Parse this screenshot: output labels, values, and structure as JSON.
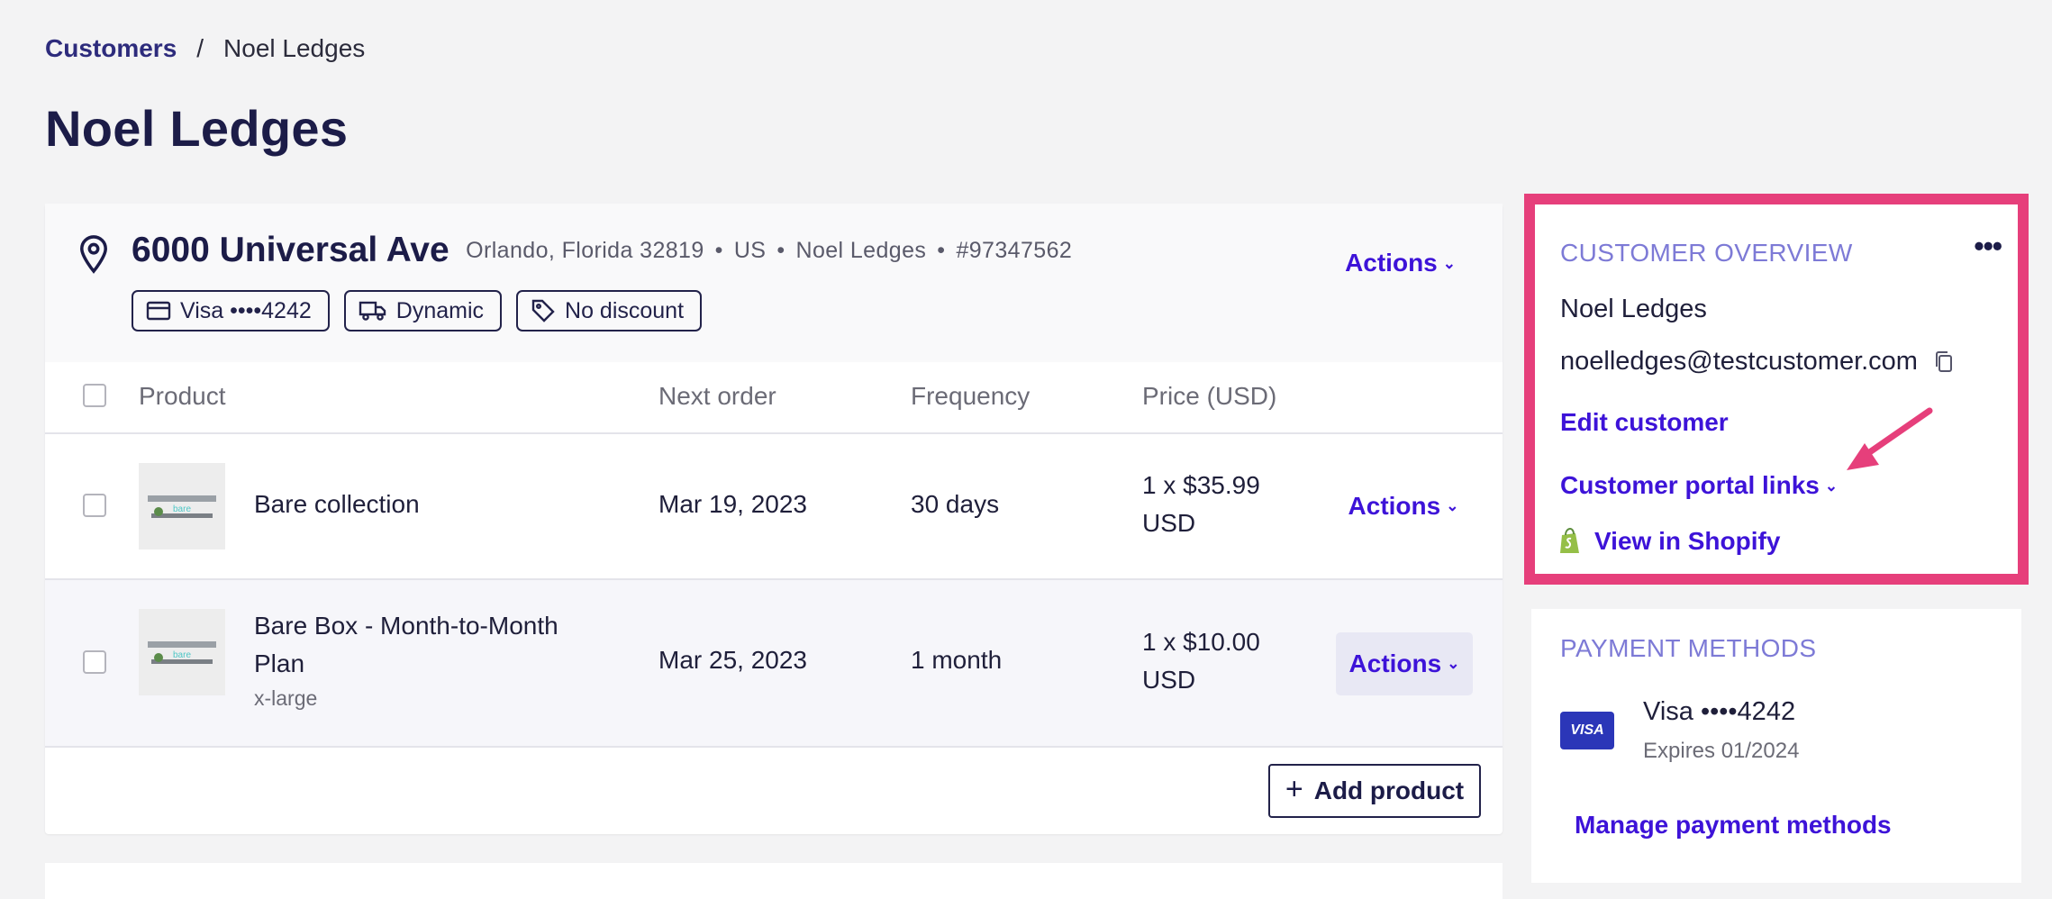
{
  "breadcrumb": {
    "parent": "Customers",
    "separator": "/",
    "current": "Noel Ledges"
  },
  "page_title": "Noel Ledges",
  "subscription": {
    "street": "6000 Universal Ave",
    "city_state_zip": "Orlando, Florida 32819",
    "country": "US",
    "customer_name": "Noel Ledges",
    "order_id": "#97347562",
    "dot": "•",
    "chips": {
      "payment": "Visa ••••4242",
      "shipping": "Dynamic",
      "discount": "No discount"
    },
    "actions_label": "Actions"
  },
  "table": {
    "headers": {
      "product": "Product",
      "next_order": "Next order",
      "frequency": "Frequency",
      "price": "Price (USD)"
    },
    "rows": [
      {
        "product": "Bare collection",
        "variant": "",
        "next_order": "Mar 19, 2023",
        "frequency": "30 days",
        "price_line1": "1 x $35.99",
        "price_line2": "USD",
        "actions": "Actions"
      },
      {
        "product_line1": "Bare Box - Month-to-Month",
        "product_line2": "Plan",
        "variant": "x-large",
        "next_order": "Mar 25, 2023",
        "frequency": "1 month",
        "price_line1": "1 x $10.00",
        "price_line2": "USD",
        "actions": "Actions"
      }
    ],
    "thumb_text": "bare",
    "add_product": "Add product"
  },
  "overview": {
    "title": "CUSTOMER OVERVIEW",
    "name": "Noel Ledges",
    "email": "noelledges@testcustomer.com",
    "edit": "Edit customer",
    "portal_links": "Customer portal links",
    "view_shopify": "View in Shopify",
    "more": "•••"
  },
  "payment_methods": {
    "title": "PAYMENT METHODS",
    "card": "Visa ••••4242",
    "expires": "Expires 01/2024",
    "brand_badge": "VISA",
    "manage": "Manage payment methods"
  },
  "colors": {
    "accent": "#3d13d8",
    "highlight_border": "#e63f7b",
    "navy": "#1c1c48",
    "section_title": "#7d7ad6"
  }
}
